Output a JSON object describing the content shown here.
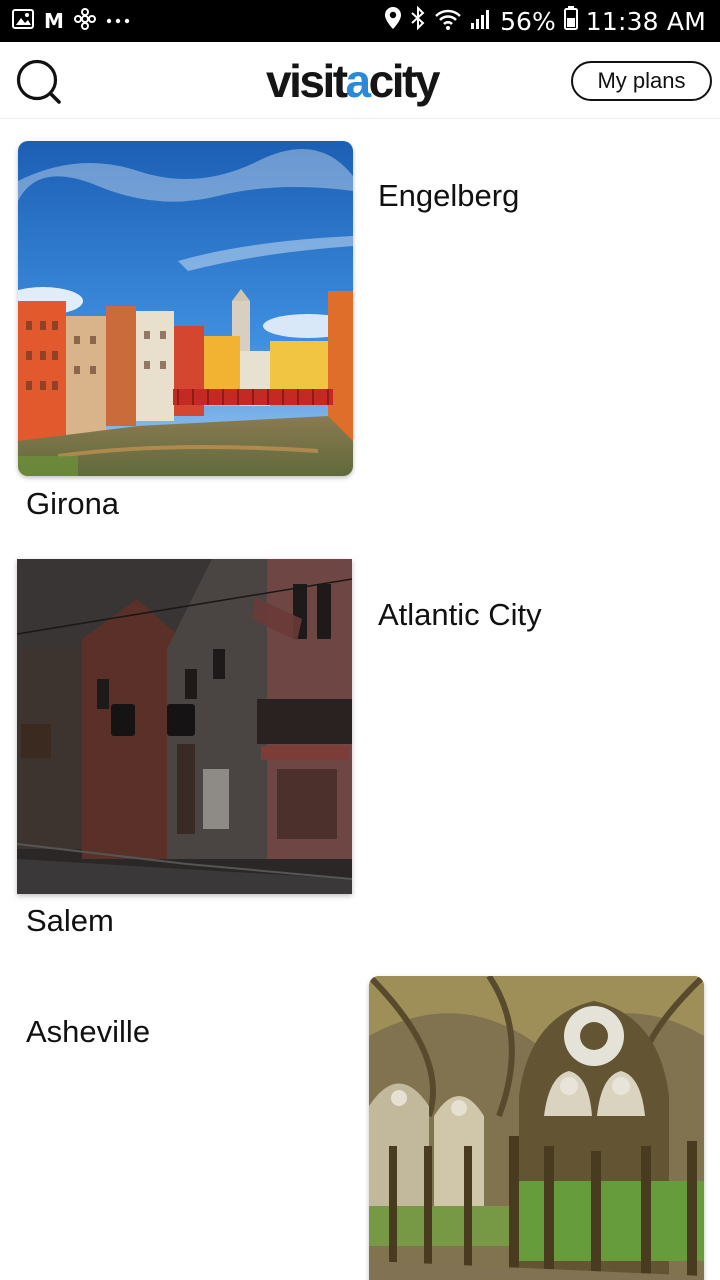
{
  "status_bar": {
    "left_icons": [
      "gallery-icon",
      "gmail-icon",
      "fan-icon",
      "more-dots-icon"
    ],
    "right_icons": [
      "location-icon",
      "bluetooth-icon",
      "wifi-icon",
      "signal-icon",
      "battery-icon"
    ],
    "battery": "56%",
    "time": "11:38 AM"
  },
  "header": {
    "logo_part1": "visit",
    "logo_accent": "a",
    "logo_part2": "city",
    "my_plans_label": "My plans",
    "accent_color": "#2a8ad8"
  },
  "cities": [
    {
      "name": "Engelberg",
      "image": null
    },
    {
      "name": "Girona",
      "image": "Girona colorful riverside houses with red bridge"
    },
    {
      "name": "Atlantic City",
      "image": null
    },
    {
      "name": "Salem",
      "image": "Salem historic wooden houses street"
    },
    {
      "name": "Asheville",
      "image": null
    },
    {
      "name": "",
      "image": "Gothic cloister arches with garden"
    }
  ]
}
